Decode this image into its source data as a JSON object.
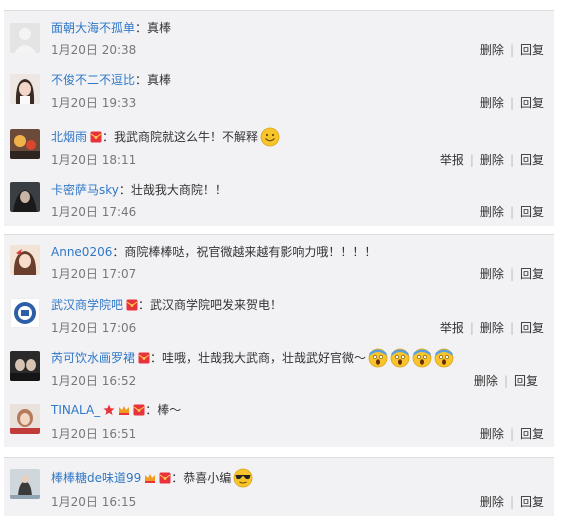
{
  "comments": [
    {
      "user": "面朝大海不孤单",
      "text": "真棒",
      "time": "1月20日 20:38",
      "actions": [
        "删除",
        "回复"
      ]
    },
    {
      "user": "不俊不二不逗比",
      "text": "真棒",
      "time": "1月20日 19:33",
      "actions": [
        "删除",
        "回复"
      ]
    },
    {
      "user": "北烟雨",
      "text": "我武商院就这么牛！不解释",
      "time": "1月20日 18:11",
      "actions": [
        "举报",
        "删除",
        "回复"
      ]
    },
    {
      "user": "卡密萨马sky",
      "text": "壮哉我大商院！！",
      "time": "1月20日 17:46",
      "actions": [
        "删除",
        "回复"
      ]
    },
    {
      "user": "Anne0206",
      "text": "商院棒棒哒，祝官微越来越有影响力哦！！！！",
      "time": "1月20日 17:07",
      "actions": [
        "删除",
        "回复"
      ]
    },
    {
      "user": "武汉商学院吧",
      "text": "武汉商学院吧发来贺电！",
      "time": "1月20日 17:06",
      "actions": [
        "举报",
        "删除",
        "回复"
      ]
    },
    {
      "user": "芮可饮水画罗裙",
      "text": "哇哦，壮哉我大武商，壮哉武好官微～",
      "time": "1月20日 16:52",
      "actions": [
        "删除",
        "回复"
      ]
    },
    {
      "user": "TINALA_",
      "text": "棒～",
      "time": "1月20日 16:51",
      "actions": [
        "删除",
        "回复"
      ]
    },
    {
      "user": "棒棒糖de味道99",
      "text": "恭喜小编",
      "time": "1月20日 16:15",
      "actions": [
        "删除",
        "回复"
      ]
    }
  ],
  "colors": {
    "username": "#2f78c6",
    "panel": "#f2f2f5",
    "badge_red": "#e8333c",
    "emoji_yellow": "#f7c52b"
  },
  "icons": {
    "member_badge": "red-envelope-badge-icon",
    "smile": "smile-emoji-icon",
    "scream": "scream-emoji-icon",
    "cool": "sunglasses-emoji-icon",
    "star": "red-star-icon",
    "crown": "crown-icon"
  }
}
